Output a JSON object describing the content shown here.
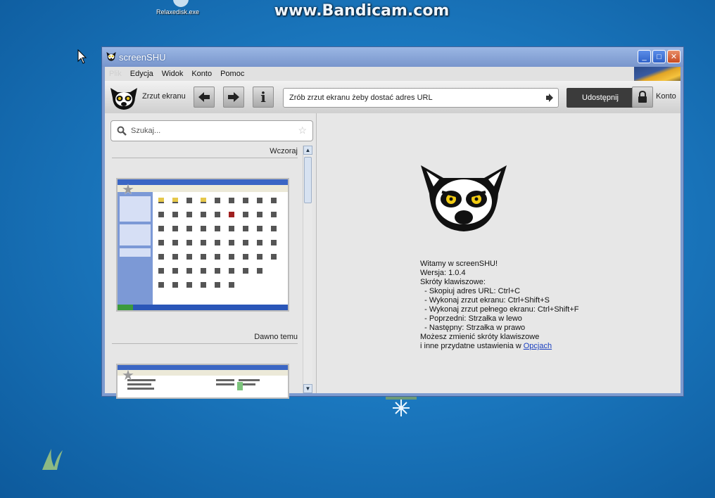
{
  "watermark": "www.Bandicam.com",
  "desktop": {
    "icon_label": "Relaxedisk.exe"
  },
  "window": {
    "title": "screenSHU",
    "controls": {
      "minimize": "_",
      "maximize": "□",
      "close": "✕"
    }
  },
  "menu": {
    "file": "Plik",
    "items": [
      "Edycja",
      "Widok",
      "Konto",
      "Pomoc"
    ]
  },
  "toolbar": {
    "capture_label": "Zrzut ekranu",
    "info_glyph": "i",
    "url_text": "Zrób zrzut ekranu żeby dostać adres URL",
    "share_label": "Udostępnij",
    "account_label": "Konto"
  },
  "sidebar": {
    "search_placeholder": "Szukaj...",
    "sections": [
      {
        "label": "Wczoraj"
      },
      {
        "label": "Dawno temu"
      }
    ]
  },
  "welcome": {
    "lines": [
      "Witamy w screenSHU!",
      "Wersja: 1.0.4",
      "Skróty klawiszowe:",
      "  - Skopiuj adres URL: Ctrl+C",
      "  - Wykonaj zrzut ekranu: Ctrl+Shift+S",
      "  - Wykonaj zrzut pełnego ekranu: Ctrl+Shift+F",
      "  - Poprzedni: Strzałka w lewo",
      "  - Następny: Strzałka w prawo",
      "Możesz zmienić skróty klawiszowe"
    ],
    "last_line_prefix": "i inne przydatne ustawienia w ",
    "options_link": "Opcjach"
  },
  "icons": {
    "app": "lemur-icon",
    "back": "arrow-left-icon",
    "forward": "arrow-right-icon",
    "info": "info-icon",
    "go": "arrow-right-small-icon",
    "lock": "lock-icon",
    "search": "search-icon",
    "favorite": "star-icon"
  },
  "colors": {
    "title_bar": "#7d9bd0",
    "share_button": "#3b3b3b",
    "link": "#1a3fbf"
  }
}
